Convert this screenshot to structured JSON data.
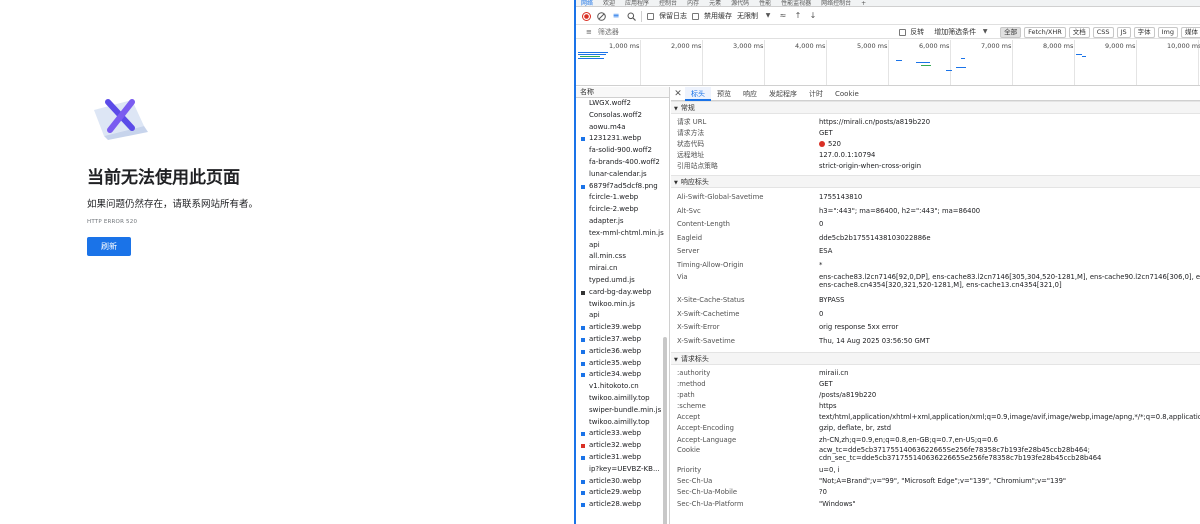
{
  "error_page": {
    "title": "当前无法使用此页面",
    "description": "如果问题仍然存在，请联系网站所有者。",
    "error_code": "HTTP ERROR 520",
    "refresh_label": "刷新"
  },
  "devtools": {
    "tabs": [
      {
        "label": "网络",
        "active": true
      },
      {
        "label": "欢迎"
      },
      {
        "label": "应用程序"
      },
      {
        "label": "控制台"
      },
      {
        "label": "内存"
      },
      {
        "label": "元素"
      },
      {
        "label": "源代码"
      },
      {
        "label": "性能"
      },
      {
        "label": "性能监视器"
      },
      {
        "label": "网络控制台"
      },
      {
        "label": "+"
      }
    ],
    "toolbar": {
      "preserve_log": "保留日志",
      "disable_cache": "禁用缓存",
      "throttle": "无限制"
    },
    "filterbar": {
      "placeholder": "筛选器",
      "invert": "反转",
      "more_filters": "增加筛选条件",
      "chips": [
        "全部",
        "Fetch/XHR",
        "文档",
        "CSS",
        "JS",
        "字体",
        "Img",
        "媒体"
      ]
    },
    "overview_ticks": [
      "1,000 ms",
      "2,000 ms",
      "3,000 ms",
      "4,000 ms",
      "5,000 ms",
      "6,000 ms",
      "7,000 ms",
      "8,000 ms",
      "9,000 ms",
      "10,000 ms"
    ],
    "name_header": "名称",
    "requests": [
      {
        "name": "LWGX.woff2",
        "icon": ""
      },
      {
        "name": "Consolas.woff2",
        "icon": ""
      },
      {
        "name": "aowu.m4a",
        "icon": ""
      },
      {
        "name": "1231231.webp",
        "icon": "img"
      },
      {
        "name": "fa-solid-900.woff2",
        "icon": ""
      },
      {
        "name": "fa-brands-400.woff2",
        "icon": ""
      },
      {
        "name": "lunar-calendar.js",
        "icon": ""
      },
      {
        "name": "6879f7ad5dcf8.png",
        "icon": "img"
      },
      {
        "name": "fcircle-1.webp",
        "icon": ""
      },
      {
        "name": "fcircle-2.webp",
        "icon": ""
      },
      {
        "name": "adapter.js",
        "icon": ""
      },
      {
        "name": "tex-mml-chtml.min.js",
        "icon": ""
      },
      {
        "name": "api",
        "icon": ""
      },
      {
        "name": "all.min.css",
        "icon": ""
      },
      {
        "name": "mirai.cn",
        "icon": ""
      },
      {
        "name": "typed.umd.js",
        "icon": ""
      },
      {
        "name": "card-bg-day.webp",
        "icon": "dark"
      },
      {
        "name": "twikoo.min.js",
        "icon": ""
      },
      {
        "name": "api",
        "icon": ""
      },
      {
        "name": "article39.webp",
        "icon": "img"
      },
      {
        "name": "article37.webp",
        "icon": "img"
      },
      {
        "name": "article36.webp",
        "icon": "img"
      },
      {
        "name": "article35.webp",
        "icon": "img"
      },
      {
        "name": "article34.webp",
        "icon": "img"
      },
      {
        "name": "v1.hitokoto.cn",
        "icon": ""
      },
      {
        "name": "twikoo.aimilly.top",
        "icon": ""
      },
      {
        "name": "swiper-bundle.min.js",
        "icon": ""
      },
      {
        "name": "twikoo.aimilly.top",
        "icon": ""
      },
      {
        "name": "article33.webp",
        "icon": "img"
      },
      {
        "name": "article32.webp",
        "icon": "red"
      },
      {
        "name": "article31.webp",
        "icon": "img"
      },
      {
        "name": "ip?key=UEVBZ-KB...",
        "icon": ""
      },
      {
        "name": "article30.webp",
        "icon": "img"
      },
      {
        "name": "article29.webp",
        "icon": "img"
      },
      {
        "name": "article28.webp",
        "icon": "img"
      }
    ],
    "detail_tabs": [
      {
        "label": "标头",
        "active": true
      },
      {
        "label": "预览"
      },
      {
        "label": "响应"
      },
      {
        "label": "发起程序"
      },
      {
        "label": "计时"
      },
      {
        "label": "Cookie"
      }
    ],
    "general": {
      "heading": "常规",
      "rows": [
        {
          "k": "请求 URL",
          "v": "https://mirali.cn/posts/a819b220"
        },
        {
          "k": "请求方法",
          "v": "GET"
        },
        {
          "k": "状态代码",
          "v": "520",
          "status": true
        },
        {
          "k": "远程地址",
          "v": "127.0.0.1:10794"
        },
        {
          "k": "引用站点策略",
          "v": "strict-origin-when-cross-origin"
        }
      ]
    },
    "response_headers": {
      "heading": "响应标头",
      "rows": [
        {
          "k": "Ali-Swift-Global-Savetime",
          "v": "1755143810"
        },
        {
          "k": "Alt-Svc",
          "v": "h3=\":443\"; ma=86400, h2=\":443\"; ma=86400"
        },
        {
          "k": "Content-Length",
          "v": "0"
        },
        {
          "k": "Eagleid",
          "v": "dde5cb2b17551438103022886e"
        },
        {
          "k": "Server",
          "v": "ESA"
        },
        {
          "k": "Timing-Allow-Origin",
          "v": "*"
        },
        {
          "k": "Via",
          "v": "ens-cache83.l2cn7146[92,0,DP], ens-cache83.l2cn7146[305,304,520-1281,M], ens-cache90.l2cn7146[306,0], ens-cache8.\nens-cache8.cn4354[320,321,520-1281,M], ens-cache13.cn4354[321,0]",
          "lines": 2
        },
        {
          "k": "X-Site-Cache-Status",
          "v": "BYPASS"
        },
        {
          "k": "X-Swift-Cachetime",
          "v": "0"
        },
        {
          "k": "X-Swift-Error",
          "v": "orig response 5xx error"
        },
        {
          "k": "X-Swift-Savetime",
          "v": "Thu, 14 Aug 2025 03:56:50 GMT"
        }
      ]
    },
    "request_headers": {
      "heading": "请求标头",
      "rows": [
        {
          "k": ":authority",
          "v": "miraii.cn"
        },
        {
          "k": ":method",
          "v": "GET"
        },
        {
          "k": ":path",
          "v": "/posts/a819b220"
        },
        {
          "k": ":scheme",
          "v": "https"
        },
        {
          "k": "Accept",
          "v": "text/html,application/xhtml+xml,application/xml;q=0.9,image/avif,image/webp,image/apng,*/*;q=0.8,application/sign"
        },
        {
          "k": "Accept-Encoding",
          "v": "gzip, deflate, br, zstd"
        },
        {
          "k": "Accept-Language",
          "v": "zh-CN,zh;q=0.9,en;q=0.8,en-GB;q=0.7,en-US;q=0.6"
        },
        {
          "k": "Cookie",
          "v": "acw_tc=dde5cb37175514063622665Se256fe78358c7b193fe28b45ccb28b464;\ncdn_sec_tc=dde5cb37175514063622665Se256fe78358c7b193fe28b45ccb28b464",
          "lines": 2
        },
        {
          "k": "Priority",
          "v": "u=0, i"
        },
        {
          "k": "Sec-Ch-Ua",
          "v": "\"Not;A=Brand\";v=\"99\", \"Microsoft Edge\";v=\"139\", \"Chromium\";v=\"139\""
        },
        {
          "k": "Sec-Ch-Ua-Mobile",
          "v": "?0"
        },
        {
          "k": "Sec-Ch-Ua-Platform",
          "v": "\"Windows\""
        }
      ]
    }
  },
  "colors": {
    "accent": "#1a73e8",
    "error": "#d93025",
    "logo_purple": "#5b4be8",
    "logo_bg": "#dde6f5"
  }
}
